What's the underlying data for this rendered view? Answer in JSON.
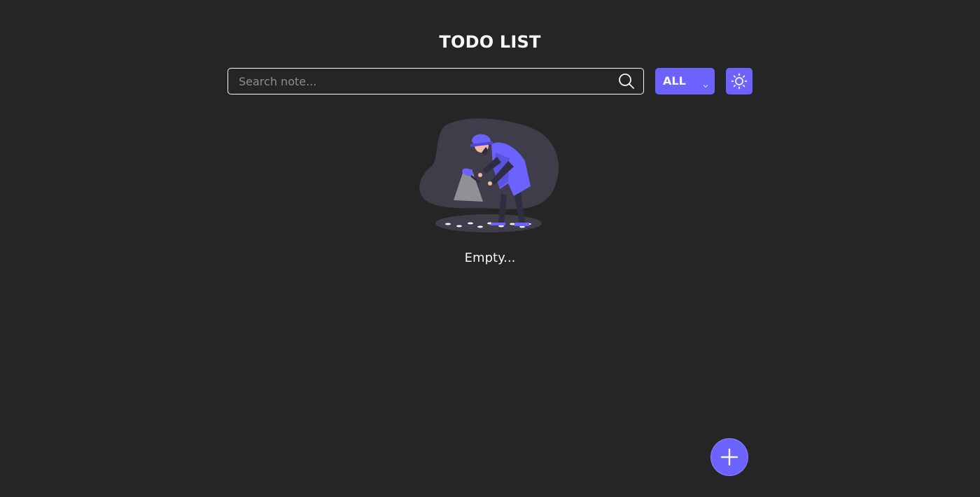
{
  "header": {
    "title": "TODO LIST"
  },
  "search": {
    "placeholder": "Search note...",
    "value": "",
    "icon": "search-icon"
  },
  "filter": {
    "selected": "ALL",
    "icon": "chevron-down-icon"
  },
  "theme_toggle": {
    "icon": "sun-icon"
  },
  "empty_state": {
    "illustration": "detective-searching-illustration",
    "message": "Empty..."
  },
  "fab": {
    "icon": "plus-icon"
  },
  "colors": {
    "background": "#252525",
    "accent": "#6c63ff",
    "text": "#f7f7f7",
    "placeholder": "#8d8d8d"
  }
}
